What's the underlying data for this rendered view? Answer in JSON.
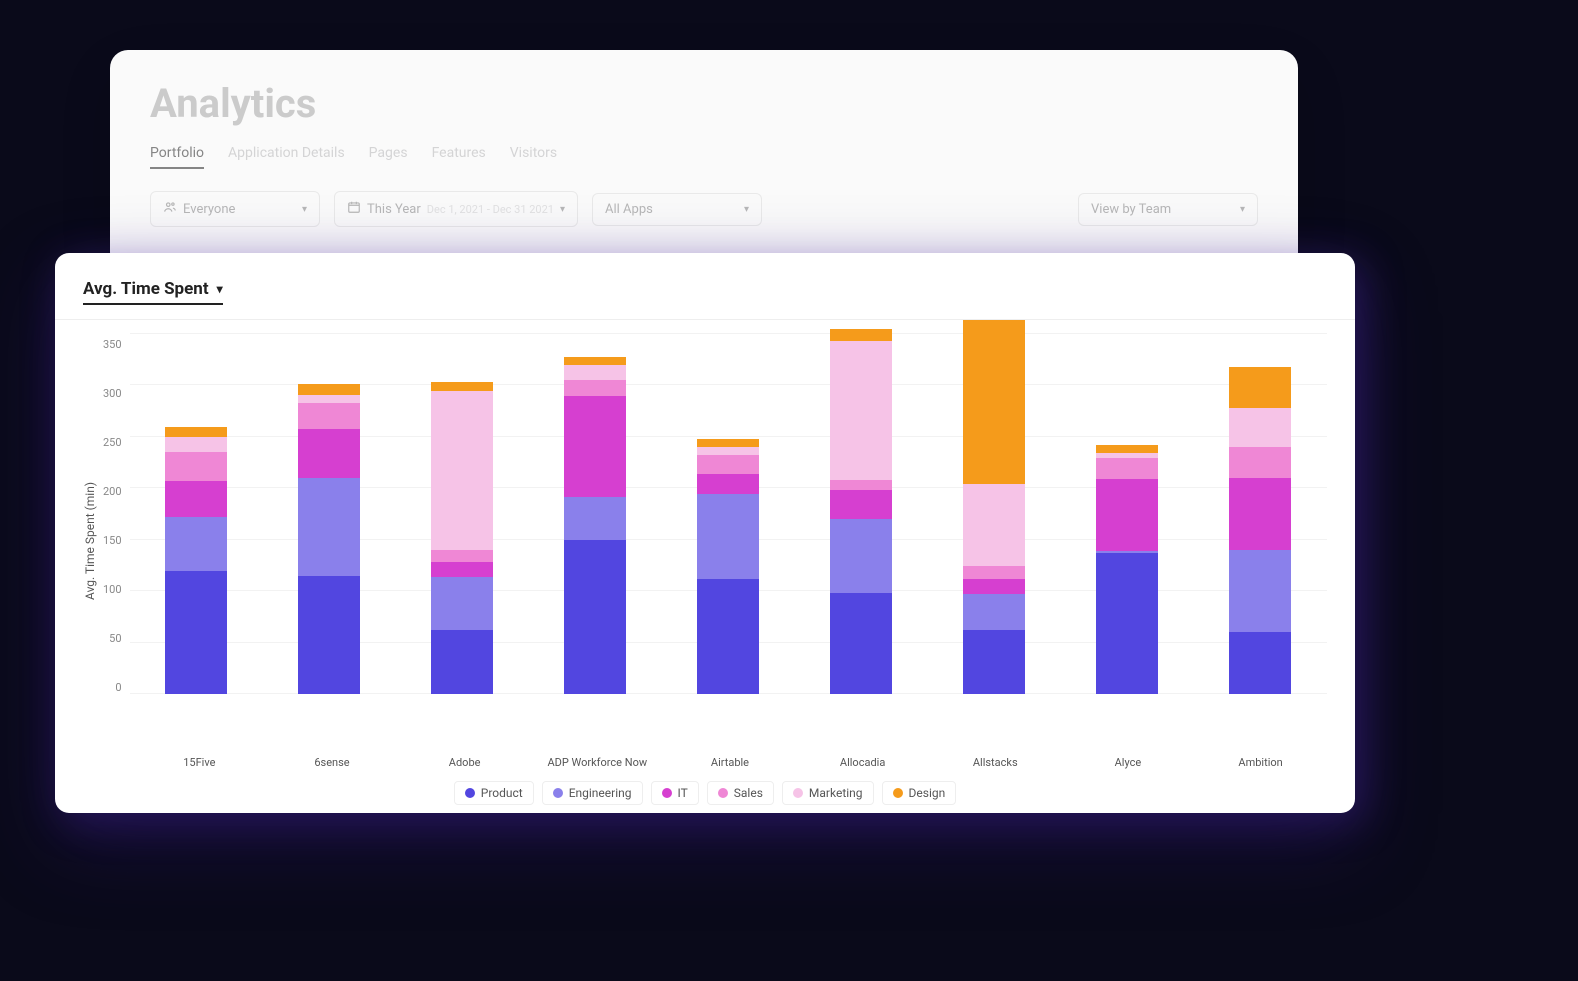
{
  "header": {
    "title": "Analytics",
    "tabs": [
      "Portfolio",
      "Application Details",
      "Pages",
      "Features",
      "Visitors"
    ],
    "active_tab": "Portfolio"
  },
  "filters": {
    "segment": {
      "label": "Everyone"
    },
    "date": {
      "label": "This Year",
      "range_hint": "Dec 1, 2021 - Dec 31 2021"
    },
    "apps": {
      "label": "All Apps"
    },
    "view": {
      "label": "View by Team"
    }
  },
  "metric_selector": {
    "label": "Avg. Time Spent"
  },
  "chart_data": {
    "type": "bar",
    "stacked": true,
    "ylabel": "Avg. Time Spent (min)",
    "xlabel": "",
    "ylim": [
      0,
      350
    ],
    "y_ticks": [
      350,
      300,
      250,
      200,
      150,
      100,
      50,
      0
    ],
    "categories": [
      "15Five",
      "6sense",
      "Adobe",
      "ADP Workforce Now",
      "Airtable",
      "Allocadia",
      "Allstacks",
      "Alyce",
      "Ambition"
    ],
    "legend": [
      "Product",
      "Engineering",
      "IT",
      "Sales",
      "Marketing",
      "Design"
    ],
    "colors": {
      "Product": "#5246e0",
      "Engineering": "#8a80eb",
      "IT": "#d63fd0",
      "Sales": "#ef87d5",
      "Marketing": "#f6c3e7",
      "Design": "#f59b1b"
    },
    "series": [
      {
        "name": "Product",
        "values": [
          120,
          115,
          62,
          150,
          112,
          98,
          62,
          137,
          60
        ]
      },
      {
        "name": "Engineering",
        "values": [
          52,
          95,
          52,
          42,
          82,
          72,
          35,
          2,
          80
        ]
      },
      {
        "name": "IT",
        "values": [
          35,
          48,
          14,
          98,
          20,
          28,
          15,
          70,
          70
        ]
      },
      {
        "name": "Sales",
        "values": [
          28,
          25,
          12,
          15,
          18,
          10,
          12,
          20,
          30
        ]
      },
      {
        "name": "Marketing",
        "values": [
          15,
          8,
          155,
          15,
          8,
          135,
          80,
          5,
          38
        ]
      },
      {
        "name": "Design",
        "values": [
          10,
          10,
          8,
          8,
          8,
          12,
          160,
          8,
          40
        ]
      }
    ]
  }
}
